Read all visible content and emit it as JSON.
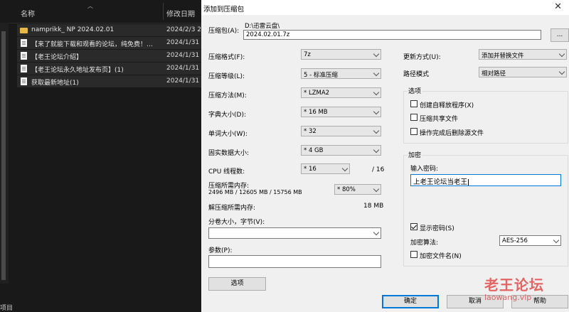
{
  "explorer": {
    "col_name": "名称",
    "col_date": "修改日期",
    "rows": [
      {
        "name": "namprikk_ NP 2024.02.01",
        "date": "2024/2/3 2",
        "type": "folder"
      },
      {
        "name": "【来了就能下载和观看的论坛，纯免费！…",
        "date": "2024/1/31",
        "type": "file"
      },
      {
        "name": "【老王论坛介绍】",
        "date": "2024/1/31",
        "type": "file"
      },
      {
        "name": "【老王论坛永久地址发布页】(1)",
        "date": "2024/1/31",
        "type": "file"
      },
      {
        "name": "获取最新地址(1)",
        "date": "2024/1/31",
        "type": "file"
      }
    ],
    "status": "项目"
  },
  "dialog": {
    "title": "添加到压缩包",
    "close": "✕",
    "archive_label": "压缩包(A):",
    "archive_dir": "D:\\迅雷云盘\\",
    "archive_name": "2024.02.01.7z",
    "browse": "...",
    "format_label": "压缩格式(F):",
    "format_value": "7z",
    "level_label": "压缩等级(L):",
    "level_value": "5 - 标准压缩",
    "method_label": "压缩方法(M):",
    "method_value": "* LZMA2",
    "dict_label": "字典大小(D):",
    "dict_value": "* 16 MB",
    "word_label": "单词大小(W):",
    "word_value": "* 32",
    "solid_label": "固实数据大小:",
    "solid_value": "* 4 GB",
    "threads_label": "CPU 线程数:",
    "threads_value": "* 16",
    "threads_total": "/ 16",
    "mem_comp_label": "压缩所需内存:",
    "mem_comp_values": "2496 MB / 12605 MB / 15756 MB",
    "mem_pct": "* 80%",
    "mem_decomp_label": "解压缩所需内存:",
    "mem_decomp_value": "18 MB",
    "split_label": "分卷大小，字节(V):",
    "split_value": "",
    "params_label": "参数(P):",
    "params_value": "",
    "options_button": "选项",
    "update_label": "更新方式(U):",
    "update_value": "添加并替换文件",
    "path_label": "路径模式",
    "path_value": "相对路径",
    "options_group": "选项",
    "opt_sfx": "创建自释放程序(X)",
    "opt_shared": "压缩共享文件",
    "opt_delete": "操作完成后删除源文件",
    "encryption_group": "加密",
    "password_label": "输入密码:",
    "password_value": "上老王论坛当老王",
    "show_password": "显示密码(S)",
    "enc_method_label": "加密算法:",
    "enc_method_value": "AES-256",
    "encrypt_names": "加密文件名(N)",
    "ok": "确定",
    "cancel": "取消",
    "help": "帮助"
  },
  "watermark": {
    "line1": "老王论坛",
    "line2": "laowang.vip"
  },
  "colors": {
    "accent": "#0078d7",
    "watermark": "#e03535",
    "explorer_bg": "#191919",
    "dialog_bg": "#f0f0f0"
  }
}
